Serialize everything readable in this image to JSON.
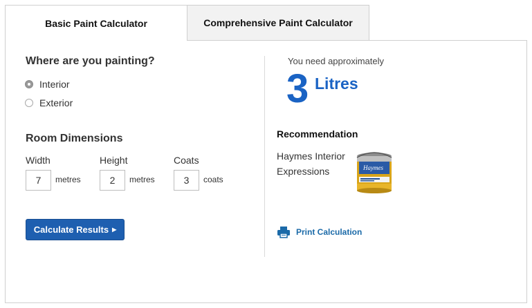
{
  "tabs": {
    "basic": "Basic Paint Calculator",
    "comprehensive": "Comprehensive Paint Calculator"
  },
  "location": {
    "heading": "Where are you painting?",
    "options": [
      {
        "label": "Interior",
        "selected": true
      },
      {
        "label": "Exterior",
        "selected": false
      }
    ]
  },
  "dimensions": {
    "heading": "Room Dimensions",
    "fields": [
      {
        "label": "Width",
        "value": "7",
        "unit": "metres"
      },
      {
        "label": "Height",
        "value": "2",
        "unit": "metres"
      },
      {
        "label": "Coats",
        "value": "3",
        "unit": "coats"
      }
    ]
  },
  "calculate_button": {
    "label": "Calculate Results",
    "arrow_icon": "play-arrow-icon"
  },
  "result": {
    "intro": "You need approximately",
    "amount": "3",
    "unit": "Litres"
  },
  "recommendation": {
    "heading": "Recommendation",
    "product": "Haymes Interior Expressions",
    "image_icon": "paint-can-icon"
  },
  "print": {
    "label": "Print Calculation",
    "icon": "printer-icon"
  },
  "colors": {
    "accent": "#1a63c4",
    "button": "#1e5fb0",
    "link": "#1b6aa8"
  }
}
